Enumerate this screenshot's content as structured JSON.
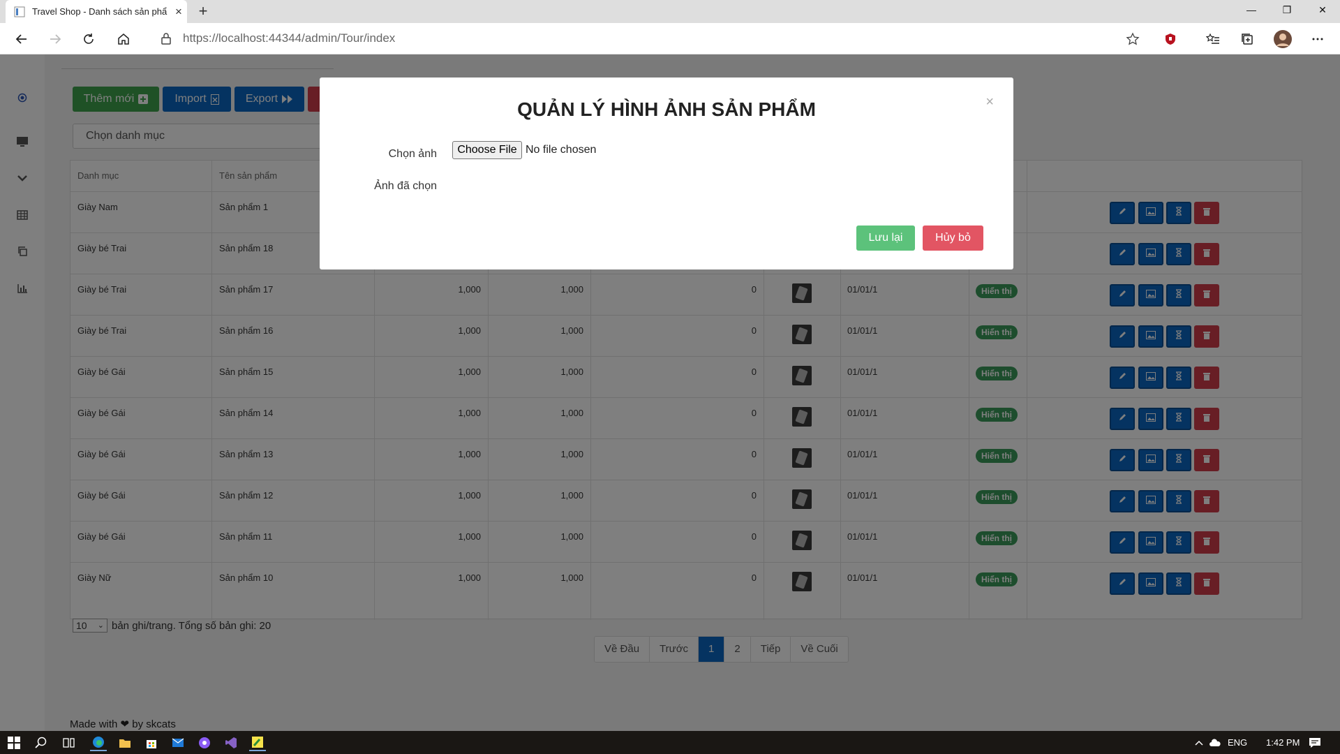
{
  "browser": {
    "tab_title": "Travel Shop - Danh sách sản phẩ",
    "new_tab_symbol": "+",
    "url_host": "https://localhost",
    "url_rest": ":44344/admin/Tour/index"
  },
  "toolbar": {
    "add_label": "Thêm mới",
    "import_label": "Import",
    "export_label": "Export",
    "category_placeholder": "Chọn danh mục"
  },
  "table": {
    "columns": [
      "Danh mục",
      "Tên sản phẩm"
    ],
    "rows": [
      {
        "category": "Giày Nam",
        "name": "Sản phẩm 1",
        "price": "",
        "sale": "",
        "qty": "",
        "date": "",
        "status": ""
      },
      {
        "category": "Giày bé Trai",
        "name": "Sản phẩm 18",
        "price": "",
        "sale": "",
        "qty": "",
        "date": "",
        "status": ""
      },
      {
        "category": "Giày bé Trai",
        "name": "Sản phẩm 17",
        "price": "1,000",
        "sale": "1,000",
        "qty": "0",
        "date": "01/01/1",
        "status": "Hiển thị"
      },
      {
        "category": "Giày bé Trai",
        "name": "Sản phẩm 16",
        "price": "1,000",
        "sale": "1,000",
        "qty": "0",
        "date": "01/01/1",
        "status": "Hiển thị"
      },
      {
        "category": "Giày bé Gái",
        "name": "Sản phẩm 15",
        "price": "1,000",
        "sale": "1,000",
        "qty": "0",
        "date": "01/01/1",
        "status": "Hiển thị"
      },
      {
        "category": "Giày bé Gái",
        "name": "Sản phẩm 14",
        "price": "1,000",
        "sale": "1,000",
        "qty": "0",
        "date": "01/01/1",
        "status": "Hiển thị"
      },
      {
        "category": "Giày bé Gái",
        "name": "Sản phẩm 13",
        "price": "1,000",
        "sale": "1,000",
        "qty": "0",
        "date": "01/01/1",
        "status": "Hiển thị"
      },
      {
        "category": "Giày bé Gái",
        "name": "Sản phẩm 12",
        "price": "1,000",
        "sale": "1,000",
        "qty": "0",
        "date": "01/01/1",
        "status": "Hiển thị"
      },
      {
        "category": "Giày bé Gái",
        "name": "Sản phẩm 11",
        "price": "1,000",
        "sale": "1,000",
        "qty": "0",
        "date": "01/01/1",
        "status": "Hiển thị"
      },
      {
        "category": "Giày Nữ",
        "name": "Sản phẩm 10",
        "price": "1,000",
        "sale": "1,000",
        "qty": "0",
        "date": "01/01/1",
        "status": "Hiển thị"
      }
    ]
  },
  "pager": {
    "page_size": "10",
    "info": "bản ghi/trang. Tổng số bản ghi: 20",
    "first": "Về Đầu",
    "prev": "Trước",
    "page1": "1",
    "page2": "2",
    "next": "Tiếp",
    "last": "Về Cuối"
  },
  "footer": {
    "made_with": "Made with",
    "by": "by skcats"
  },
  "modal": {
    "title": "QUẢN LÝ HÌNH ẢNH SẢN PHẨM",
    "close": "×",
    "choose_label": "Chọn ảnh",
    "selected_label": "Ảnh đã chọn",
    "file_button": "Choose File",
    "file_status": "No file chosen",
    "save": "Lưu lại",
    "cancel": "Hủy bỏ"
  },
  "taskbar": {
    "lang": "ENG",
    "time": "1:42 PM"
  },
  "colors": {
    "primary": "#0a66c2",
    "success": "#3fa34d",
    "danger": "#d13c4b",
    "badge": "#3a9b5a"
  }
}
